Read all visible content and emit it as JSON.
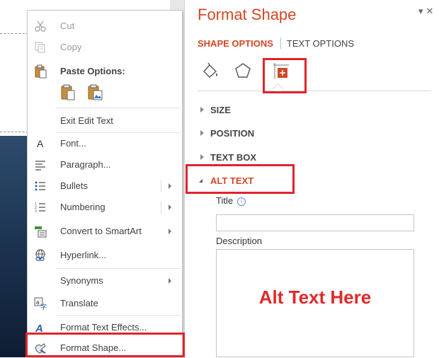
{
  "context_menu": {
    "items": [
      {
        "label": "Cut",
        "icon": "scissors-icon",
        "disabled": true
      },
      {
        "label": "Copy",
        "icon": "copy-icon",
        "disabled": true
      },
      {
        "label": "Paste Options:",
        "icon": "paste-icon"
      },
      {
        "label": "Exit Edit Text"
      },
      {
        "label": "Font...",
        "icon": "font-icon"
      },
      {
        "label": "Paragraph...",
        "icon": "paragraph-icon"
      },
      {
        "label": "Bullets",
        "icon": "bullets-icon",
        "submenu": true
      },
      {
        "label": "Numbering",
        "icon": "numbering-icon",
        "submenu": true
      },
      {
        "label": "Convert to SmartArt",
        "icon": "smartart-icon",
        "submenu": true
      },
      {
        "label": "Hyperlink...",
        "icon": "hyperlink-icon"
      },
      {
        "label": "Synonyms",
        "submenu": true
      },
      {
        "label": "Translate",
        "icon": "translate-icon"
      },
      {
        "label": "Format Text Effects...",
        "icon": "text-effects-icon"
      },
      {
        "label": "Format Shape...",
        "icon": "format-shape-icon"
      }
    ]
  },
  "pane": {
    "title": "Format Shape",
    "tabs": [
      "SHAPE OPTIONS",
      "TEXT OPTIONS"
    ],
    "icons": [
      "fill-line-icon",
      "effects-icon",
      "size-properties-icon"
    ],
    "sections": [
      "SIZE",
      "POSITION",
      "TEXT BOX",
      "ALT TEXT"
    ],
    "title_field_label": "Title",
    "description_field_label": "Description",
    "description_value": "Alt Text Here",
    "accent_color": "#d24726",
    "highlight_color": "#e0242a"
  }
}
